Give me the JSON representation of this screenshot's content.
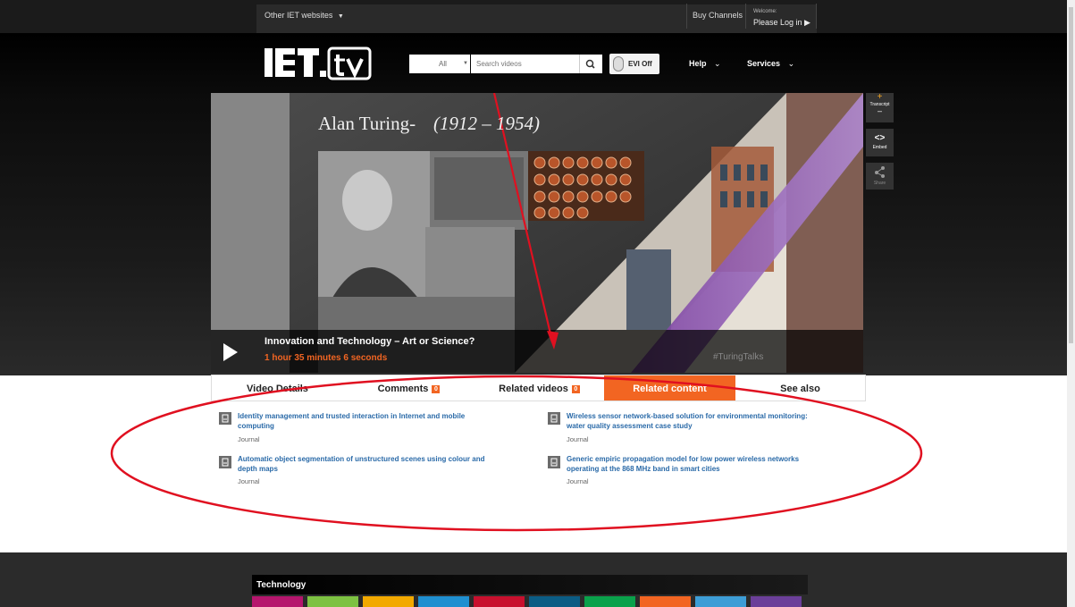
{
  "topbar": {
    "other_sites": "Other IET websites",
    "buy_channels": "Buy Channels",
    "welcome": "Welcome:",
    "login": "Please Log in ▶"
  },
  "header": {
    "search_category": "All",
    "search_placeholder": "Search videos",
    "evi_label": "EVI Off",
    "nav_help": "Help",
    "nav_services": "Services"
  },
  "video": {
    "slide_title": "Alan Turing-",
    "slide_years": "(1912 – 1954)",
    "title": "Innovation and Technology – Art or Science?",
    "duration": "1 hour 35 minutes 6 seconds",
    "hashtag": "#TuringTalks",
    "side_transcript": "Transcript",
    "side_embed": "Embed",
    "side_share": "Share"
  },
  "tabs": [
    {
      "label": "Video Details"
    },
    {
      "label": "Comments",
      "badge": "0"
    },
    {
      "label": "Related videos",
      "badge": "0"
    },
    {
      "label": "Related content"
    },
    {
      "label": "See also"
    }
  ],
  "results": [
    {
      "title_l1": "Identity management and trusted interaction in Internet and mobile",
      "title_l2": "computing",
      "type": "Journal"
    },
    {
      "title_l1": "Wireless sensor network-based solution for environmental monitoring:",
      "title_l2": "water quality assessment case study",
      "type": "Journal"
    },
    {
      "title_l1": "Automatic object segmentation of unstructured scenes using colour and",
      "title_l2": "depth maps",
      "type": "Journal"
    },
    {
      "title_l1": "Generic empiric propagation model for low power wireless networks",
      "title_l2": "operating at the 868 MHz band in smart cities",
      "type": "Journal"
    }
  ],
  "footer": {
    "technology_label": "Technology",
    "tile_colors": [
      "#b5166d",
      "#7dc242",
      "#f2a900",
      "#1f8fd0",
      "#c8102e",
      "#0b5c84",
      "#0aa14b",
      "#f26522",
      "#3d9dd6",
      "#6b3f99"
    ]
  },
  "colors": {
    "accent_orange": "#f26522",
    "link_blue": "#2a6aa8",
    "annotation_red": "#e01020"
  }
}
